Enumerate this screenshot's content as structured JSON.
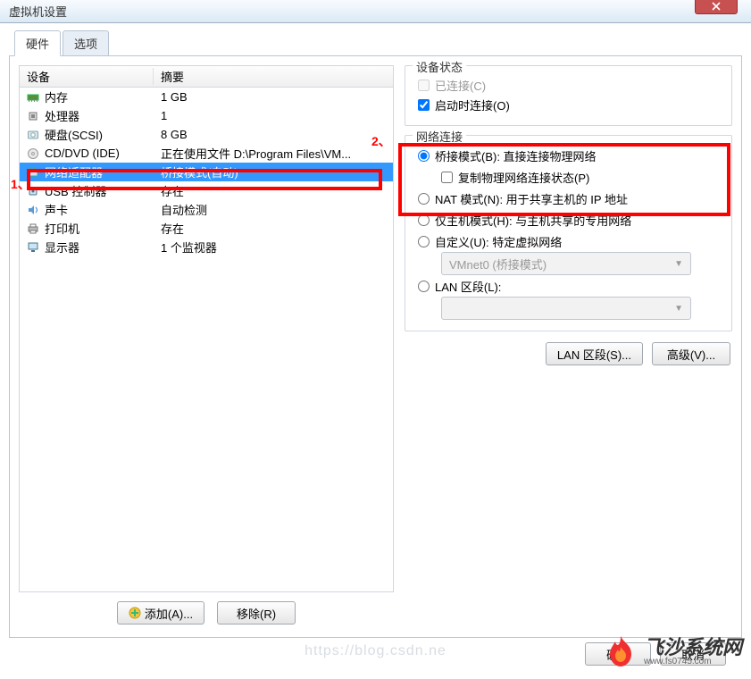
{
  "window": {
    "title": "虚拟机设置"
  },
  "tabs": {
    "hardware": "硬件",
    "options": "选项"
  },
  "table": {
    "col_device": "设备",
    "col_summary": "摘要",
    "rows": [
      {
        "icon": "memory",
        "name": "内存",
        "summary": "1 GB"
      },
      {
        "icon": "cpu",
        "name": "处理器",
        "summary": "1"
      },
      {
        "icon": "hdd",
        "name": "硬盘(SCSI)",
        "summary": "8 GB"
      },
      {
        "icon": "cd",
        "name": "CD/DVD (IDE)",
        "summary": "正在使用文件 D:\\Program Files\\VM..."
      },
      {
        "icon": "net",
        "name": "网络适配器",
        "summary": "桥接模式(自动)"
      },
      {
        "icon": "usb",
        "name": "USB 控制器",
        "summary": "存在"
      },
      {
        "icon": "sound",
        "name": "声卡",
        "summary": "自动检测"
      },
      {
        "icon": "printer",
        "name": "打印机",
        "summary": "存在"
      },
      {
        "icon": "display",
        "name": "显示器",
        "summary": "1 个监视器"
      }
    ],
    "selected_index": 4
  },
  "buttons": {
    "add": "添加(A)...",
    "remove": "移除(R)",
    "ok": "确定",
    "cancel": "取消",
    "lan_segment": "LAN 区段(S)...",
    "advanced": "高级(V)..."
  },
  "device_state": {
    "legend": "设备状态",
    "connected": "已连接(C)",
    "connect_at_poweron": "启动时连接(O)"
  },
  "net": {
    "legend": "网络连接",
    "bridged": "桥接模式(B): 直接连接物理网络",
    "replicate": "复制物理网络连接状态(P)",
    "nat": "NAT 模式(N): 用于共享主机的 IP 地址",
    "hostonly": "仅主机模式(H): 与主机共享的专用网络",
    "custom": "自定义(U): 特定虚拟网络",
    "vmnet": "VMnet0 (桥接模式)",
    "lan": "LAN 区段(L):"
  },
  "annotations": {
    "a1": "1、",
    "a2": "2、"
  },
  "watermark": "https://blog.csdn.ne",
  "brand": {
    "name": "飞沙系统网",
    "url": "www.fs0745.com"
  }
}
